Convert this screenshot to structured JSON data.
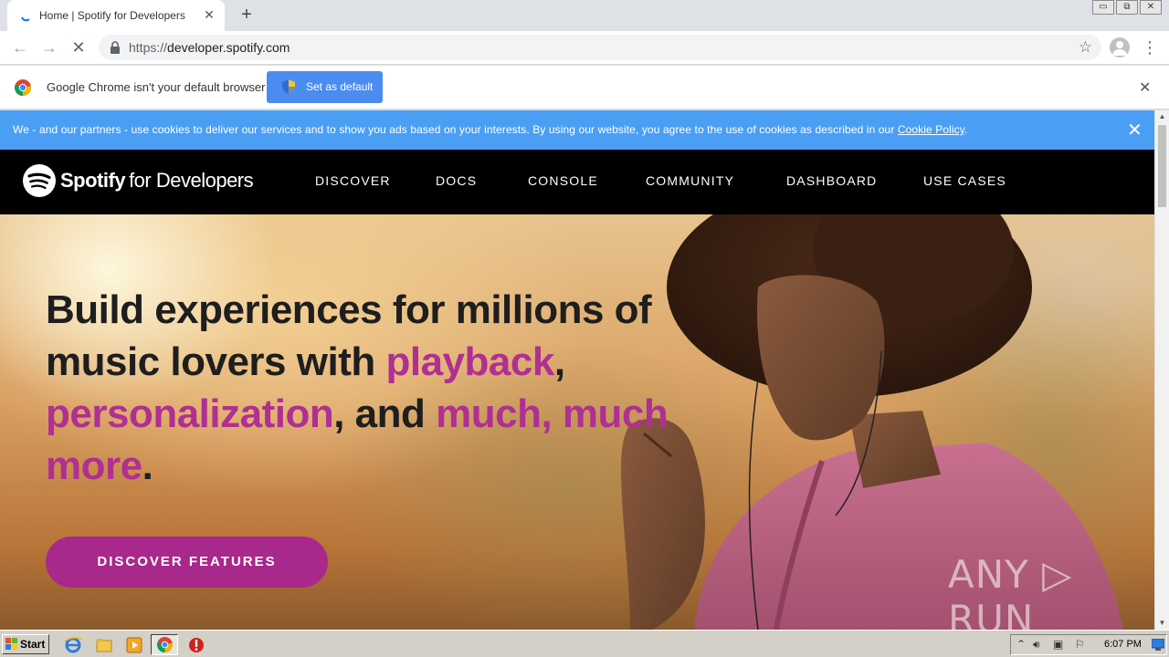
{
  "browser": {
    "tab_title": "Home | Spotify for Developers",
    "tab_close": "✕",
    "new_tab": "+",
    "url_scheme": "https://",
    "url_host": "developer.spotify.com",
    "window_buttons": [
      "▭",
      "⧉",
      "✕"
    ]
  },
  "infobar": {
    "message": "Google Chrome isn't your default browser",
    "button_label": "Set as default",
    "close": "✕"
  },
  "cookie_banner": {
    "text": "We - and our partners - use cookies to deliver our services and to show you ads based on your interests. By using our website, you agree to the use of cookies as described in our ",
    "link": "Cookie Policy",
    "suffix": ".",
    "close": "✕"
  },
  "site": {
    "logo_word": "Spotify",
    "logo_sub": "for Developers",
    "nav": [
      "DISCOVER",
      "DOCS",
      "CONSOLE",
      "COMMUNITY",
      "DASHBOARD",
      "USE CASES"
    ],
    "hero": {
      "t1": "Build experiences for millions of music lovers with ",
      "a1": "playback",
      "t2": ", ",
      "a2": "personalization",
      "t3": ", and ",
      "a3": "much, much more",
      "t4": "."
    },
    "cta": "DISCOVER FEATURES",
    "watermark": "ANY ▷ RUN"
  },
  "taskbar": {
    "start": "Start",
    "clock": "6:07 PM"
  },
  "colors": {
    "cookie_bar": "#4a9ff5",
    "accent": "#b02f93",
    "cta": "#a8288c",
    "nav_bg": "#000000"
  }
}
